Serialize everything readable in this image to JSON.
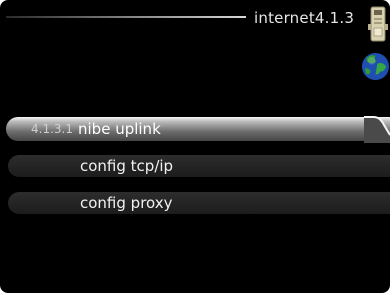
{
  "header": {
    "title": "internet4.1.3"
  },
  "icons": {
    "device": "device-icon",
    "globe": "globe-icon"
  },
  "menu": {
    "items": [
      {
        "number": "4.1.3.1",
        "label": "nibe uplink",
        "selected": true
      },
      {
        "number": "",
        "label": "config tcp/ip",
        "selected": false
      },
      {
        "number": "",
        "label": "config proxy",
        "selected": false
      }
    ]
  },
  "colors": {
    "background": "#000000",
    "text": "#f2f2f2",
    "selected_highlight": "#bdbdbd"
  }
}
